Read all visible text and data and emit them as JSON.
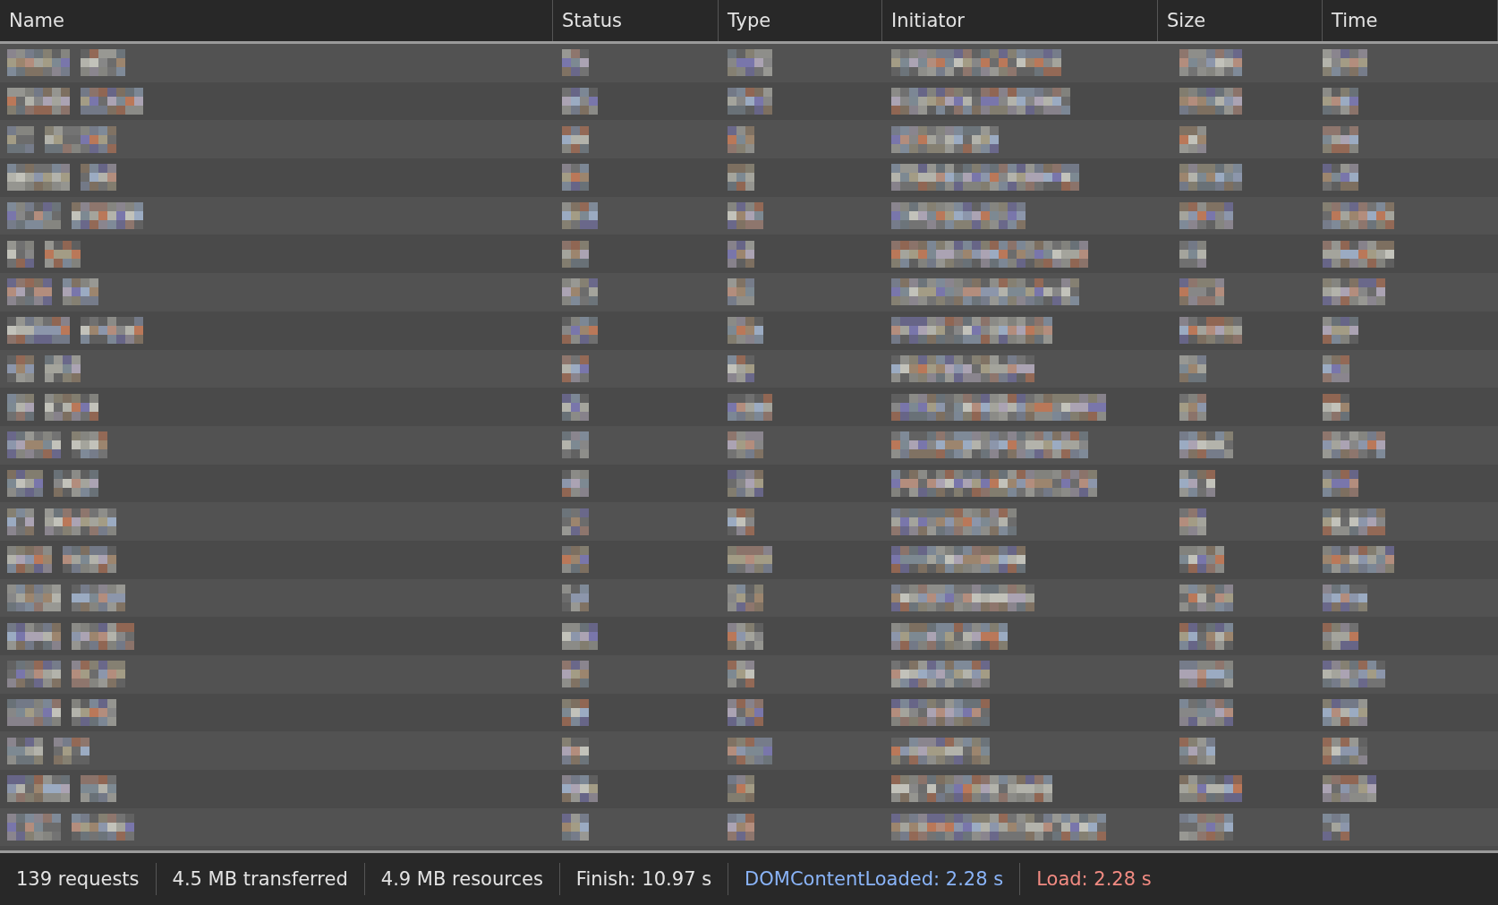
{
  "table": {
    "columns": [
      {
        "label": "Name"
      },
      {
        "label": "Status"
      },
      {
        "label": "Type"
      },
      {
        "label": "Initiator"
      },
      {
        "label": "Size"
      },
      {
        "label": "Time"
      }
    ],
    "rows": [
      {
        "kind": "pixelated"
      },
      {
        "kind": "pixelated"
      },
      {
        "kind": "pixelated"
      },
      {
        "kind": "pixelated"
      },
      {
        "kind": "pixelated"
      },
      {
        "kind": "pixelated"
      },
      {
        "kind": "pixelated"
      },
      {
        "kind": "pixelated"
      },
      {
        "kind": "pixelated"
      },
      {
        "kind": "pixelated"
      },
      {
        "kind": "pixelated"
      },
      {
        "kind": "pixelated"
      },
      {
        "kind": "pixelated"
      },
      {
        "kind": "pixelated"
      },
      {
        "kind": "pixelated"
      },
      {
        "kind": "pixelated"
      },
      {
        "kind": "pixelated"
      },
      {
        "kind": "pixelated"
      },
      {
        "kind": "pixelated"
      },
      {
        "kind": "pixelated"
      },
      {
        "kind": "pixelated"
      }
    ]
  },
  "status_bar": [
    {
      "text": "139 requests",
      "kind": "plain"
    },
    {
      "text": "4.5 MB transferred",
      "kind": "plain"
    },
    {
      "text": "4.9 MB resources",
      "kind": "plain"
    },
    {
      "text": "Finish: 10.97 s",
      "kind": "plain"
    },
    {
      "text": "DOMContentLoaded: 2.28 s",
      "kind": "dom"
    },
    {
      "text": "Load: 2.28 s",
      "kind": "load"
    }
  ]
}
